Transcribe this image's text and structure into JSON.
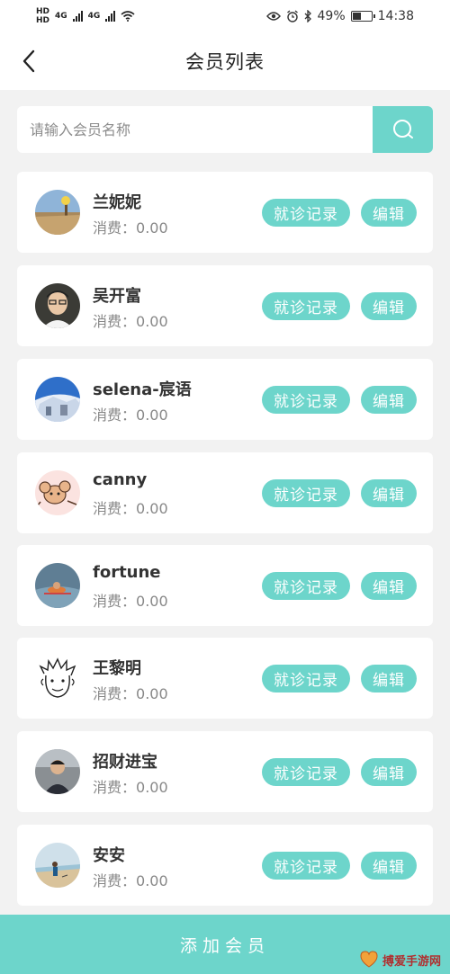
{
  "status_bar": {
    "left_label_1": "HD",
    "left_label_2": "HD",
    "net_1": "4G",
    "net_2": "4G",
    "battery": "49%",
    "battery_level": 0.49,
    "time": "14:38"
  },
  "header": {
    "title": "会员列表"
  },
  "search": {
    "placeholder": "请输入会员名称",
    "value": ""
  },
  "members": [
    {
      "name": "兰妮妮",
      "spend_label": "消费：",
      "spend": "0.00",
      "records_label": "就诊记录",
      "edit_label": "编辑"
    },
    {
      "name": "吴开富",
      "spend_label": "消费：",
      "spend": "0.00",
      "records_label": "就诊记录",
      "edit_label": "编辑"
    },
    {
      "name": "selena-宸语",
      "spend_label": "消费：",
      "spend": "0.00",
      "records_label": "就诊记录",
      "edit_label": "编辑"
    },
    {
      "name": "canny",
      "spend_label": "消费：",
      "spend": "0.00",
      "records_label": "就诊记录",
      "edit_label": "编辑"
    },
    {
      "name": "fortune",
      "spend_label": "消费：",
      "spend": "0.00",
      "records_label": "就诊记录",
      "edit_label": "编辑"
    },
    {
      "name": "王黎明",
      "spend_label": "消费：",
      "spend": "0.00",
      "records_label": "就诊记录",
      "edit_label": "编辑"
    },
    {
      "name": "招财进宝",
      "spend_label": "消费：",
      "spend": "0.00",
      "records_label": "就诊记录",
      "edit_label": "编辑"
    },
    {
      "name": "安安",
      "spend_label": "消费：",
      "spend": "0.00",
      "records_label": "就诊记录",
      "edit_label": "编辑"
    }
  ],
  "footer": {
    "add_label": "添加会员"
  },
  "watermark": {
    "text": "搏爱手游网"
  },
  "colors": {
    "accent": "#6dd5cb",
    "background": "#f2f2f2",
    "card": "#ffffff"
  }
}
